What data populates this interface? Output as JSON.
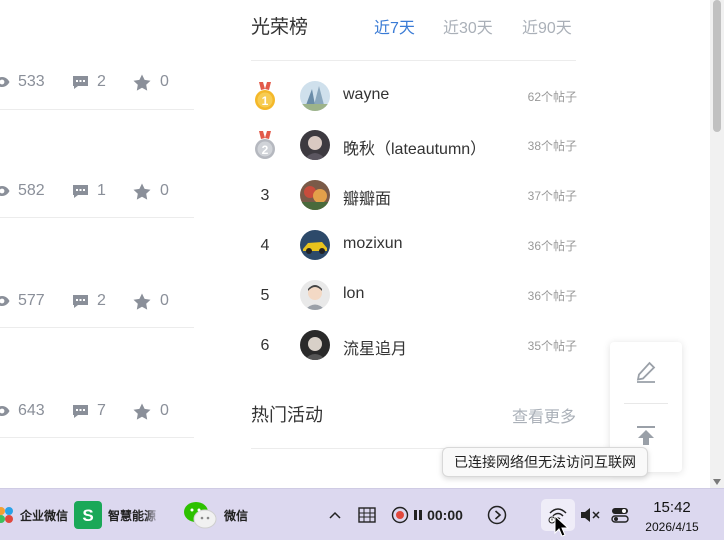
{
  "left_stats": [
    {
      "views": "533",
      "comments": "2",
      "stars": "0"
    },
    {
      "views": "582",
      "comments": "1",
      "stars": "0"
    },
    {
      "views": "577",
      "comments": "2",
      "stars": "0"
    },
    {
      "views": "643",
      "comments": "7",
      "stars": "0"
    }
  ],
  "leaderboard": {
    "title": "光荣榜",
    "tabs": [
      {
        "label": "近7天",
        "active": true
      },
      {
        "label": "近30天",
        "active": false
      },
      {
        "label": "近90天",
        "active": false
      }
    ],
    "entries": [
      {
        "rank": "1",
        "badge": "gold-medal-icon",
        "name": "wayne",
        "posts": "62个帖子"
      },
      {
        "rank": "2",
        "badge": "silver-medal-icon",
        "name": "晚秋（lateautumn）",
        "posts": "38个帖子"
      },
      {
        "rank": "3",
        "badge": "",
        "name": "瓣瓣面",
        "posts": "37个帖子"
      },
      {
        "rank": "4",
        "badge": "",
        "name": "mozixun",
        "posts": "36个帖子"
      },
      {
        "rank": "5",
        "badge": "",
        "name": "lon",
        "posts": "36个帖子"
      },
      {
        "rank": "6",
        "badge": "",
        "name": "流星追月",
        "posts": "35个帖子"
      }
    ]
  },
  "hot_activities": {
    "title": "热门活动",
    "more_label": "查看更多"
  },
  "tooltip": {
    "text": "已连接网络但无法访问互联网"
  },
  "taskbar": {
    "apps": [
      {
        "label": "企业微信",
        "icon": "wecom-icon"
      },
      {
        "label": "智慧能源",
        "icon": "smart-energy-icon"
      },
      {
        "label": "微信",
        "icon": "wechat-icon"
      }
    ],
    "timer_text": "00:00",
    "clock_time": "15:42",
    "clock_date": "2026/4/15"
  },
  "colors": {
    "accent": "#3a7bd5",
    "muted": "#aab0b8",
    "taskbar_bg": "#dcd8ef"
  }
}
